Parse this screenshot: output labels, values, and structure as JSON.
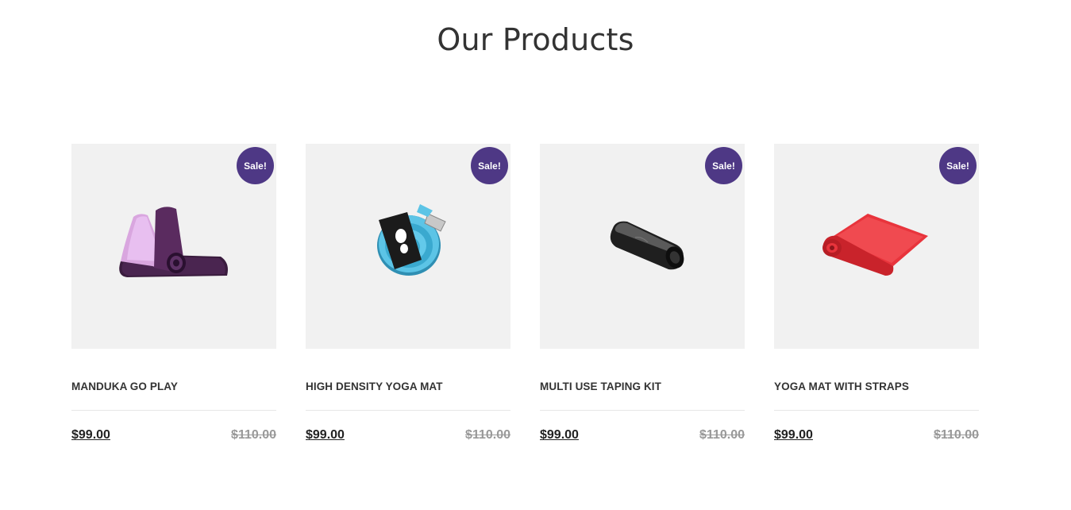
{
  "section": {
    "title": "Our Products"
  },
  "products": [
    {
      "name": "MANDUKA GO PLAY",
      "badge": "Sale!",
      "price": "$99.00",
      "old_price": "$110.00",
      "image_icon": "purple-yoga-mat-icon"
    },
    {
      "name": "HIGH DENSITY YOGA MAT",
      "badge": "Sale!",
      "price": "$99.00",
      "old_price": "$110.00",
      "image_icon": "blue-yoga-strap-icon"
    },
    {
      "name": "MULTI USE TAPING KIT",
      "badge": "Sale!",
      "price": "$99.00",
      "old_price": "$110.00",
      "image_icon": "black-foam-roller-icon"
    },
    {
      "name": "YOGA MAT WITH STRAPS",
      "badge": "Sale!",
      "price": "$99.00",
      "old_price": "$110.00",
      "image_icon": "red-yoga-mat-icon"
    }
  ],
  "colors": {
    "badge": "#4e3885",
    "image_bg": "#f1f1f1",
    "old_price": "#999999"
  }
}
